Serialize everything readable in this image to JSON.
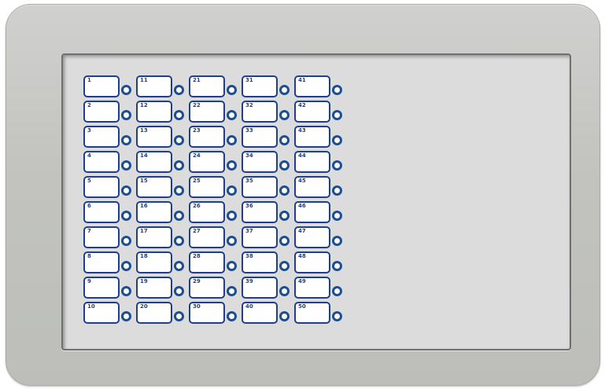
{
  "panel": {
    "tags": [
      {
        "number": "1"
      },
      {
        "number": "2"
      },
      {
        "number": "3"
      },
      {
        "number": "4"
      },
      {
        "number": "5"
      },
      {
        "number": "6"
      },
      {
        "number": "7"
      },
      {
        "number": "8"
      },
      {
        "number": "9"
      },
      {
        "number": "10"
      },
      {
        "number": "11"
      },
      {
        "number": "12"
      },
      {
        "number": "13"
      },
      {
        "number": "14"
      },
      {
        "number": "15"
      },
      {
        "number": "16"
      },
      {
        "number": "17"
      },
      {
        "number": "18"
      },
      {
        "number": "19"
      },
      {
        "number": "20"
      },
      {
        "number": "21"
      },
      {
        "number": "22"
      },
      {
        "number": "23"
      },
      {
        "number": "24"
      },
      {
        "number": "25"
      },
      {
        "number": "26"
      },
      {
        "number": "27"
      },
      {
        "number": "28"
      },
      {
        "number": "29"
      },
      {
        "number": "30"
      },
      {
        "number": "31"
      },
      {
        "number": "32"
      },
      {
        "number": "33"
      },
      {
        "number": "34"
      },
      {
        "number": "35"
      },
      {
        "number": "36"
      },
      {
        "number": "37"
      },
      {
        "number": "38"
      },
      {
        "number": "39"
      },
      {
        "number": "40"
      },
      {
        "number": "41"
      },
      {
        "number": "42"
      },
      {
        "number": "43"
      },
      {
        "number": "44"
      },
      {
        "number": "45"
      },
      {
        "number": "46"
      },
      {
        "number": "47"
      },
      {
        "number": "48"
      },
      {
        "number": "49"
      },
      {
        "number": "50"
      }
    ]
  },
  "colors": {
    "frame": "#c4c5c1",
    "screen": "#dcdcdc",
    "tag_border": "#1e3f8a",
    "ring": "#1f4e8f"
  }
}
